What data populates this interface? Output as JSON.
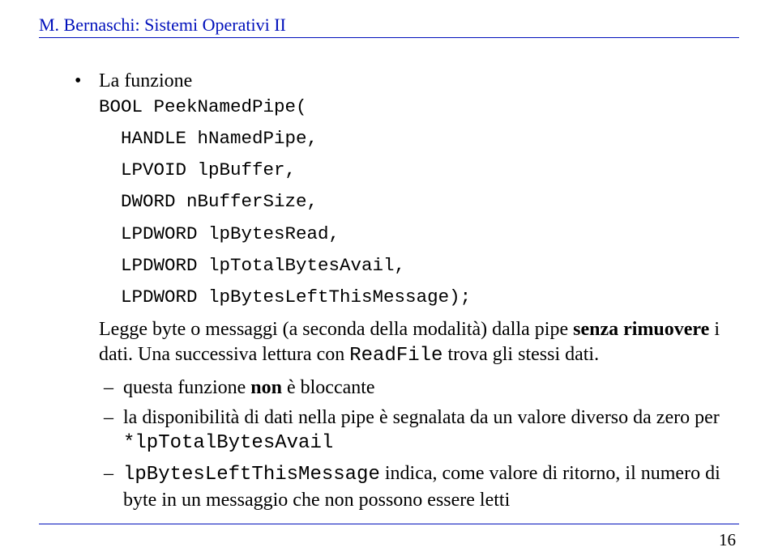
{
  "header": "M. Bernaschi: Sistemi Operativi II",
  "bullet_lead": "La funzione",
  "code": {
    "l1": "BOOL PeekNamedPipe(",
    "l2": "  HANDLE hNamedPipe,",
    "l3": "  LPVOID lpBuffer,",
    "l4": "  DWORD nBufferSize,",
    "l5": "  LPDWORD lpBytesRead,",
    "l6": "  LPDWORD lpTotalBytesAvail,",
    "l7": "  LPDWORD lpBytesLeftThisMessage);"
  },
  "para1_a": "Legge byte o messaggi (a seconda della modalità) dalla pipe ",
  "para1_bold": "senza rimuovere",
  "para1_b": " i dati. Una successiva lettura con ",
  "para1_tt": "ReadFile",
  "para1_c": " trova gli stessi dati.",
  "sub1_a": "questa funzione ",
  "sub1_bold": "non",
  "sub1_b": " è bloccante",
  "sub2_a": "la disponibilità di dati nella pipe è segnalata da un valore diverso da zero per ",
  "sub2_tt": "*lpTotalBytesAvail",
  "sub3_tt": "lpBytesLeftThisMessage",
  "sub3_a": " indica, come valore di ritorno, il numero di byte in un messaggio che non possono essere letti",
  "page_number": "16"
}
